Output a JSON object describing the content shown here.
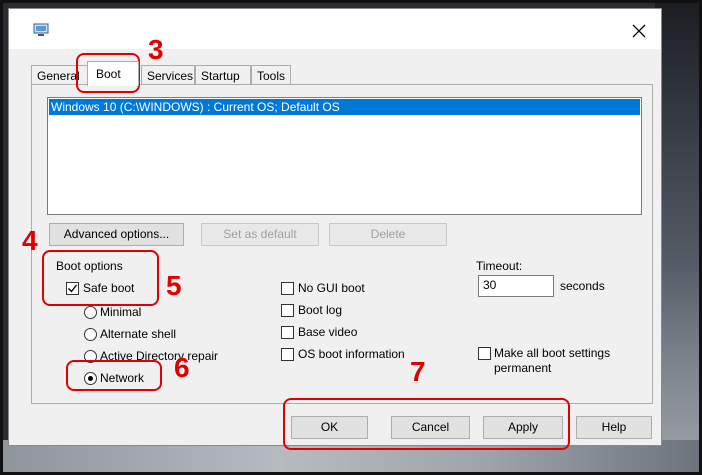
{
  "dialog": {
    "tabs": [
      "General",
      "Boot",
      "Services",
      "Startup",
      "Tools"
    ],
    "os_list": [
      "Windows 10 (C:\\WINDOWS) : Current OS; Default OS"
    ],
    "buttons": {
      "advanced": "Advanced options...",
      "set_default": "Set as default",
      "delete": "Delete"
    },
    "boot_options": {
      "group_label": "Boot options",
      "safe_boot": {
        "label": "Safe boot",
        "checked": true
      },
      "radios": [
        {
          "label": "Minimal",
          "checked": false
        },
        {
          "label": "Alternate shell",
          "checked": false
        },
        {
          "label": "Active Directory repair",
          "checked": false
        },
        {
          "label": "Network",
          "checked": true
        }
      ],
      "right_checks": [
        {
          "label": "No GUI boot",
          "checked": false
        },
        {
          "label": "Boot log",
          "checked": false
        },
        {
          "label": "Base video",
          "checked": false
        },
        {
          "label": "OS boot information",
          "checked": false
        }
      ]
    },
    "timeout": {
      "label": "Timeout:",
      "value": "30",
      "unit": "seconds"
    },
    "make_permanent": {
      "label_line1": "Make all boot settings",
      "label_line2": "permanent",
      "checked": false
    },
    "footer": {
      "ok": "OK",
      "cancel": "Cancel",
      "apply": "Apply",
      "help": "Help"
    }
  },
  "annotations": [
    "3",
    "4",
    "5",
    "6",
    "7"
  ],
  "colors": {
    "annotation": "#e00000",
    "selection": "#0078d7"
  }
}
